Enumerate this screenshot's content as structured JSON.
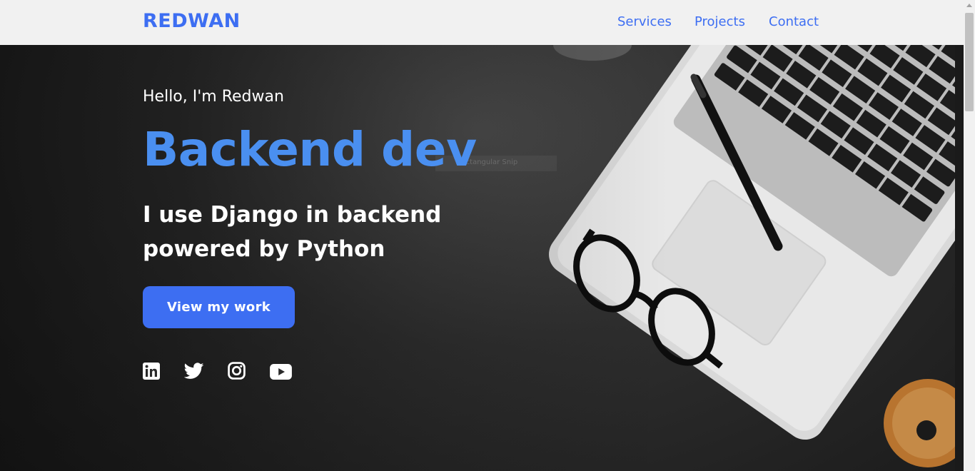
{
  "header": {
    "logo": "REDWAN",
    "nav": [
      {
        "label": "Services"
      },
      {
        "label": "Projects"
      },
      {
        "label": "Contact"
      }
    ]
  },
  "hero": {
    "greeting": "Hello, I'm Redwan",
    "headline": "Backend dev",
    "subhead": "I use Django in backend powered by Python",
    "cta_label": "View my work",
    "overlay_text": "Rectangular Snip",
    "socials": [
      {
        "icon": "linkedin-icon"
      },
      {
        "icon": "twitter-icon"
      },
      {
        "icon": "instagram-icon"
      },
      {
        "icon": "youtube-icon"
      }
    ]
  },
  "colors": {
    "accent": "#3d6ef2",
    "headline": "#4a8ff0",
    "header_bg": "#f1f1f1"
  }
}
